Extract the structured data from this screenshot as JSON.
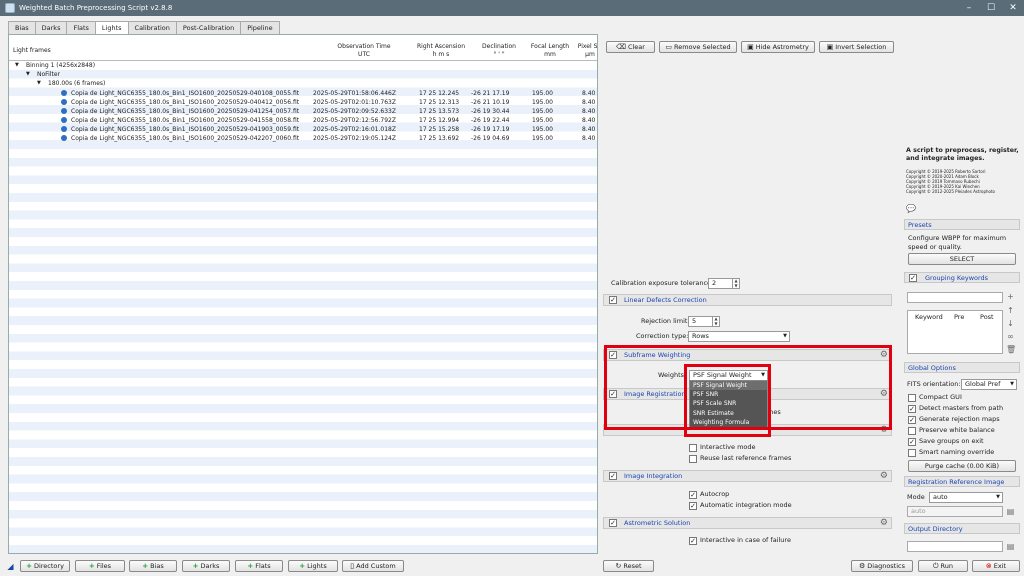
{
  "window": {
    "title": "Weighted Batch Preprocessing Script v2.8.8"
  },
  "tabs": [
    "Bias",
    "Darks",
    "Flats",
    "Lights",
    "Calibration",
    "Post-Calibration",
    "Pipeline"
  ],
  "table": {
    "columns": [
      {
        "title": "Light frames",
        "sub": ""
      },
      {
        "title": "Observation Time",
        "sub": "UTC"
      },
      {
        "title": "Right Ascension",
        "sub": "h  m  s"
      },
      {
        "title": "Declination",
        "sub": "°  '  \""
      },
      {
        "title": "Focal Length",
        "sub": "mm"
      },
      {
        "title": "Pixel Siz",
        "sub": "µm"
      }
    ],
    "groups": [
      "Binning 1 (4256x2848)",
      "NoFilter",
      "180.00s (6 frames)"
    ],
    "rows": [
      {
        "file": "Copia de Light_NGC6355_180.0s_Bin1_ISO1600_20250529-040108_0055.fit",
        "time": "2025-05-29T01:58:06.446Z",
        "ra": "17 25 12.245",
        "dec": "-26 21 17.19",
        "fl": "195.00",
        "px": "8.40"
      },
      {
        "file": "Copia de Light_NGC6355_180.0s_Bin1_ISO1600_20250529-040412_0056.fit",
        "time": "2025-05-29T02:01:10.763Z",
        "ra": "17 25 12.313",
        "dec": "-26 21 10.19",
        "fl": "195.00",
        "px": "8.40"
      },
      {
        "file": "Copia de Light_NGC6355_180.0s_Bin1_ISO1600_20250529-041254_0057.fit",
        "time": "2025-05-29T02:09:52.633Z",
        "ra": "17 25 13.573",
        "dec": "-26 19 30.44",
        "fl": "195.00",
        "px": "8.40"
      },
      {
        "file": "Copia de Light_NGC6355_180.0s_Bin1_ISO1600_20250529-041558_0058.fit",
        "time": "2025-05-29T02:12:56.792Z",
        "ra": "17 25 12.994",
        "dec": "-26 19 22.44",
        "fl": "195.00",
        "px": "8.40"
      },
      {
        "file": "Copia de Light_NGC6355_180.0s_Bin1_ISO1600_20250529-041903_0059.fit",
        "time": "2025-05-29T02:16:01.018Z",
        "ra": "17 25 15.258",
        "dec": "-26 19 17.19",
        "fl": "195.00",
        "px": "8.40"
      },
      {
        "file": "Copia de Light_NGC6355_180.0s_Bin1_ISO1600_20250529-042207_0060.fit",
        "time": "2025-05-29T02:19:05.124Z",
        "ra": "17 25 13.692",
        "dec": "-26 19 04.69",
        "fl": "195.00",
        "px": "8.40"
      }
    ]
  },
  "toolbar": {
    "clear": "Clear",
    "remove": "Remove Selected",
    "hide": "Hide Astrometry",
    "invert": "Invert Selection"
  },
  "calib": {
    "label": "Calibration exposure tolerance:",
    "value": "2"
  },
  "ldc": {
    "title": "Linear Defects Correction",
    "rej_label": "Rejection limit:",
    "rej_value": "5",
    "type_label": "Correction type:",
    "type_value": "Rows"
  },
  "sw": {
    "title": "Subframe Weighting",
    "weights_label": "Weights:",
    "weights_value": "PSF Signal Weight",
    "options": [
      "PSF Signal Weight",
      "PSF SNR",
      "PSF Scale SNR",
      "SNR Estimate",
      "Weighting Formula"
    ]
  },
  "ir": {
    "title": "Image Registration",
    "hidden_text": "mes",
    "interactive": "Interactive mode",
    "reuse": "Reuse last reference frames"
  },
  "ii": {
    "title": "Image Integration",
    "autocrop": "Autocrop",
    "auto_mode": "Automatic integration mode"
  },
  "as": {
    "title": "Astrometric Solution",
    "interactive": "Interactive in case of failure"
  },
  "about": {
    "heading": "A script to preprocess, register, and integrate images.",
    "copyright": [
      "Copyright © 2019-2025 Roberto Sartori",
      "Copyright © 2020-2021 Adam Block",
      "Copyright © 2019 Tommaso Rubechi",
      "Copyright © 2019-2025 Kai Wiechen",
      "Copyright © 2012-2025 Pleiades Astrophoto"
    ]
  },
  "presets": {
    "title": "Presets",
    "text": "Configure WBPP for maximum speed or quality.",
    "button": "SELECT"
  },
  "grouping": {
    "title": "Grouping Keywords",
    "cols": [
      "Keyword",
      "Pre",
      "Post"
    ]
  },
  "global": {
    "title": "Global Options",
    "fits_label": "FITS orientation:",
    "fits_value": "Global Pref",
    "options": [
      {
        "label": "Compact GUI",
        "checked": false
      },
      {
        "label": "Detect masters from path",
        "checked": true
      },
      {
        "label": "Generate rejection maps",
        "checked": true
      },
      {
        "label": "Preserve white balance",
        "checked": false
      },
      {
        "label": "Save groups on exit",
        "checked": true
      },
      {
        "label": "Smart naming override",
        "checked": false
      }
    ],
    "purge": "Purge cache (0.00 KiB)"
  },
  "regref": {
    "title": "Registration Reference Image",
    "mode_label": "Mode",
    "mode_value": "auto",
    "field": "auto"
  },
  "outdir": {
    "title": "Output Directory"
  },
  "bottom": {
    "directory": "Directory",
    "files": "Files",
    "bias": "Bias",
    "darks": "Darks",
    "flats": "Flats",
    "lights": "Lights",
    "add_custom": "Add Custom",
    "reset": "Reset",
    "diagnostics": "Diagnostics",
    "run": "Run",
    "exit": "Exit"
  },
  "colors": {
    "highlight": "#e00010",
    "section_title": "#1a44b0",
    "dropdown_bg": "#555555",
    "add_icon": "#2a9d3a"
  }
}
